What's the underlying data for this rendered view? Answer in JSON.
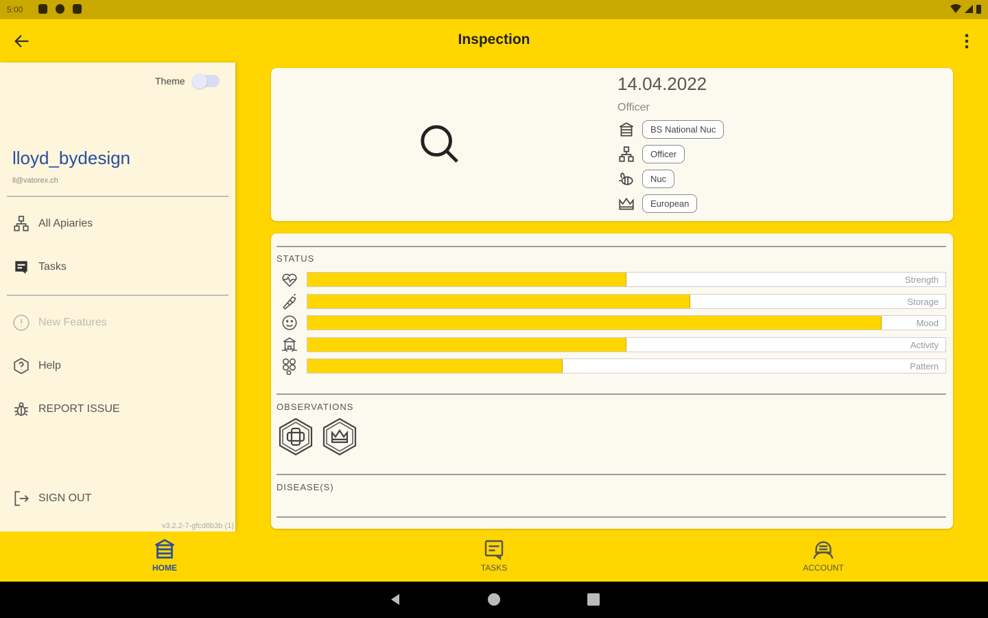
{
  "status_bar": {
    "time": "5:00"
  },
  "app_bar": {
    "title": "Inspection"
  },
  "drawer": {
    "theme_label": "Theme",
    "theme_on": false,
    "user_name": "lloyd_bydesign",
    "user_email": "ll@vatorex.ch",
    "items": [
      {
        "label": "All Apiaries",
        "icon": "hive-group-icon"
      },
      {
        "label": "Tasks",
        "icon": "tasks-icon"
      },
      {
        "label": "New Features",
        "icon": "new-features-icon",
        "disabled": true
      },
      {
        "label": "Help",
        "icon": "help-icon"
      },
      {
        "label": "REPORT ISSUE",
        "icon": "bug-icon"
      },
      {
        "label": "SIGN OUT",
        "icon": "sign-out-icon"
      }
    ],
    "version": "v3.2.2-7-gfcd8b3b (1)"
  },
  "inspection": {
    "date": "14.04.2022",
    "role": "Officer",
    "chips": [
      {
        "icon": "apiary-icon",
        "label": "BS National Nuc"
      },
      {
        "icon": "hive-icon",
        "label": "Officer"
      },
      {
        "icon": "bee-icon",
        "label": "Nuc"
      },
      {
        "icon": "queen-crown-icon",
        "label": "European"
      }
    ]
  },
  "status": {
    "title": "STATUS",
    "rows": [
      {
        "label": "Strength",
        "value": 0.5,
        "icon": "strength-icon"
      },
      {
        "label": "Storage",
        "value": 0.6,
        "icon": "storage-icon"
      },
      {
        "label": "Mood",
        "value": 0.9,
        "icon": "mood-icon"
      },
      {
        "label": "Activity",
        "value": 0.5,
        "icon": "activity-icon"
      },
      {
        "label": "Pattern",
        "value": 0.4,
        "icon": "pattern-icon"
      }
    ]
  },
  "observations": {
    "title": "OBSERVATIONS",
    "items": [
      "brood-frame-icon",
      "queen-seen-icon"
    ]
  },
  "diseases": {
    "title": "DISEASE(S)"
  },
  "bottom_nav": [
    {
      "label": "HOME",
      "active": true
    },
    {
      "label": "TASKS",
      "active": false
    },
    {
      "label": "ACCOUNT",
      "active": false
    }
  ],
  "colors": {
    "accent": "#ffd600",
    "link": "#2a4da0",
    "panel": "#fcf9ef"
  }
}
